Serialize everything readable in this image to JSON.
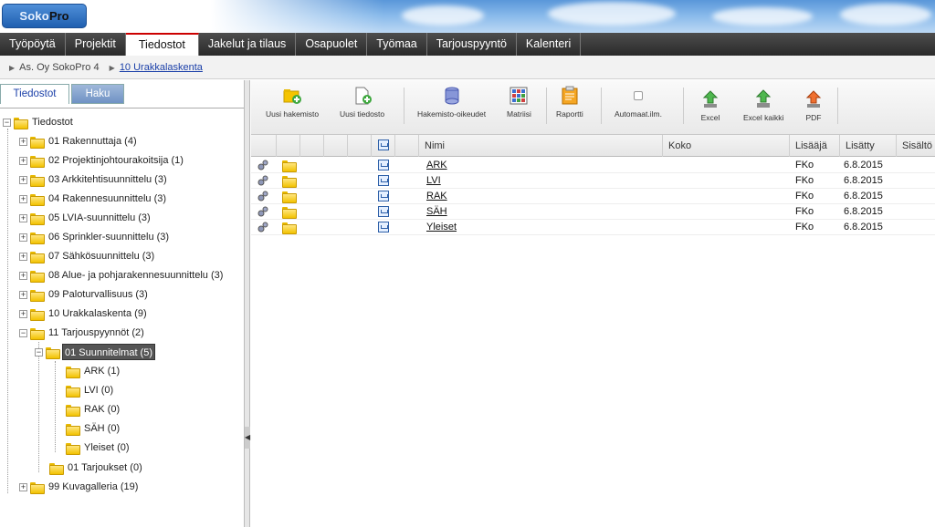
{
  "header": {
    "logo_part1": "Soko",
    "logo_part2": "Pro"
  },
  "nav": {
    "tabs": [
      {
        "label": "Työpöytä",
        "active": false
      },
      {
        "label": "Projektit",
        "active": false
      },
      {
        "label": "Tiedostot",
        "active": true
      },
      {
        "label": "Jakelut ja tilaus",
        "active": false
      },
      {
        "label": "Osapuolet",
        "active": false
      },
      {
        "label": "Työmaa",
        "active": false
      },
      {
        "label": "Tarjouspyyntö",
        "active": false
      },
      {
        "label": "Kalenteri",
        "active": false
      }
    ],
    "active_color": "#cc0000"
  },
  "breadcrumb": {
    "project": "As. Oy SokoPro 4",
    "current": "10 Urakkalaskenta"
  },
  "left_tabs": {
    "files": "Tiedostot",
    "search": "Haku"
  },
  "tree": {
    "root": "Tiedostot",
    "items": [
      {
        "label": "01 Rakennuttaja (4)"
      },
      {
        "label": "02 Projektinjohtourakoitsija (1)"
      },
      {
        "label": "03 Arkkitehtisuunnittelu (3)"
      },
      {
        "label": "04 Rakennesuunnittelu (3)"
      },
      {
        "label": "05 LVIA-suunnittelu (3)"
      },
      {
        "label": "06 Sprinkler-suunnittelu (3)"
      },
      {
        "label": "07 Sähkösuunnittelu (3)"
      },
      {
        "label": "08 Alue- ja pohjarakennesuunnittelu (3)"
      },
      {
        "label": "09 Paloturvallisuus (3)"
      },
      {
        "label": "10 Urakkalaskenta (9)"
      },
      {
        "label": "11 Tarjouspyynnöt (2)"
      }
    ],
    "sub_selected": "01 Suunnitelmat (5)",
    "sub_children": [
      {
        "label": "ARK (1)"
      },
      {
        "label": "LVI (0)"
      },
      {
        "label": "RAK (0)"
      },
      {
        "label": "SÄH (0)"
      },
      {
        "label": "Yleiset (0)"
      }
    ],
    "sub_offers": "01 Tarjoukset (0)",
    "last": "99 Kuvagalleria (19)"
  },
  "toolbar": {
    "new_folder": "Uusi hakemisto",
    "new_file": "Uusi tiedosto",
    "folder_rights": "Hakemisto-oikeudet",
    "matrix": "Matriisi",
    "report": "Raportti",
    "auto_notify": "Automaat.ilm.",
    "excel": "Excel",
    "excel_all": "Excel kaikki",
    "pdf": "PDF"
  },
  "grid": {
    "headers": {
      "name": "Nimi",
      "size": "Koko",
      "added_by": "Lisääjä",
      "added": "Lisätty",
      "content": "Sisältö"
    },
    "rows": [
      {
        "name": "ARK",
        "size": "",
        "added_by": "FKo",
        "added": "6.8.2015"
      },
      {
        "name": "LVI",
        "size": "",
        "added_by": "FKo",
        "added": "6.8.2015"
      },
      {
        "name": "RAK",
        "size": "",
        "added_by": "FKo",
        "added": "6.8.2015"
      },
      {
        "name": "SÄH",
        "size": "",
        "added_by": "FKo",
        "added": "6.8.2015"
      },
      {
        "name": "Yleiset",
        "size": "",
        "added_by": "FKo",
        "added": "6.8.2015"
      }
    ]
  }
}
